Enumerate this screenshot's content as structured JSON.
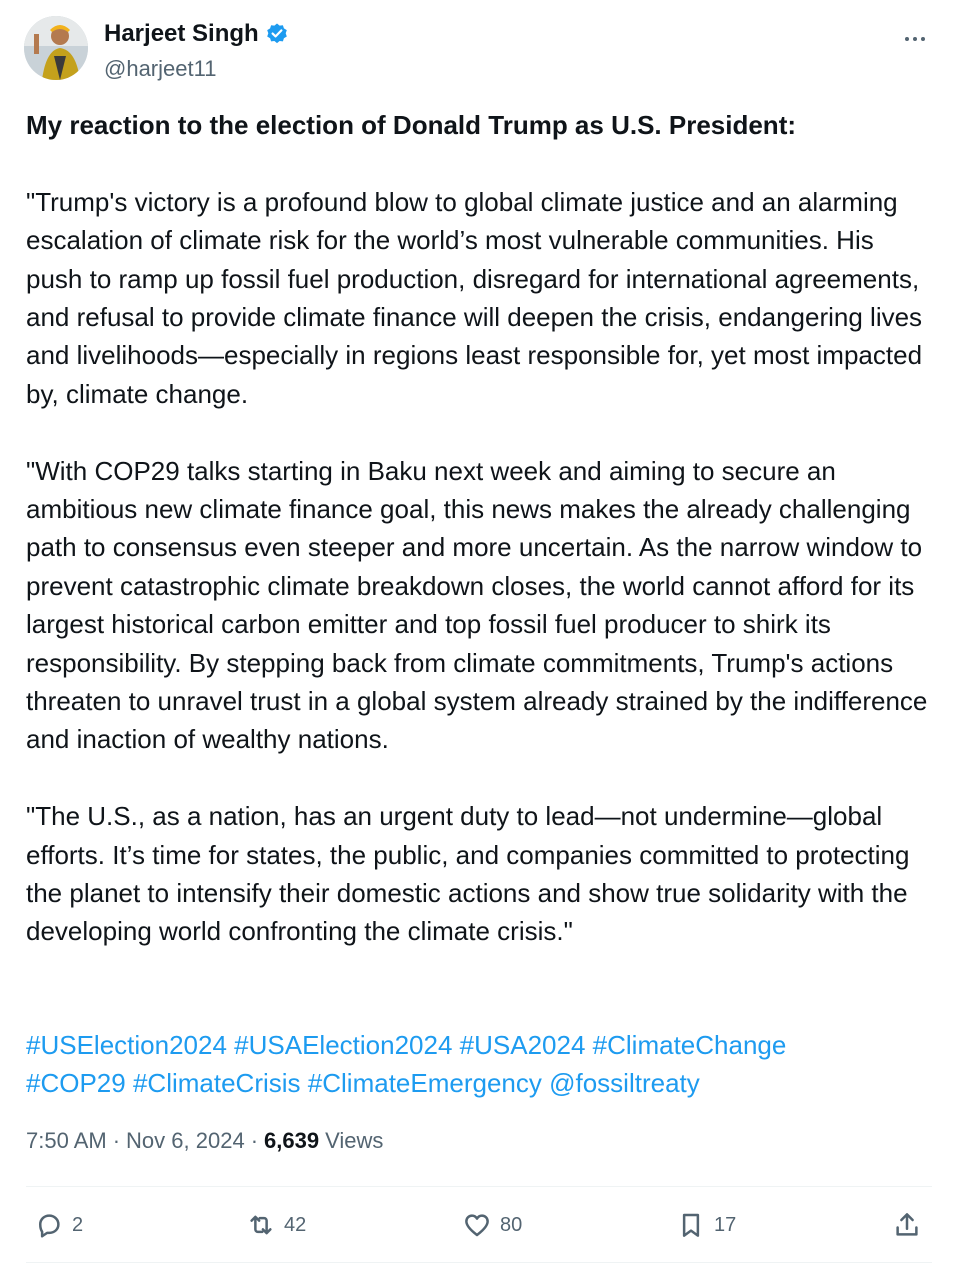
{
  "author": {
    "display_name": "Harjeet Singh",
    "handle": "@harjeet11",
    "verified": true,
    "avatar_icon": "profile-photo"
  },
  "post": {
    "lead": "My reaction to the election of Donald Trump as U.S. President:",
    "paragraphs": [
      "\"Trump's victory is a profound blow to global climate justice and an alarming escalation of climate risk for the world’s most vulnerable communities. His push to ramp up fossil fuel production, disregard for international agreements, and refusal to provide climate finance will deepen the crisis, endangering lives and livelihoods—especially in regions least responsible for, yet most impacted by, climate change.",
      "\"With COP29 talks starting in Baku next week and aiming to secure an ambitious new climate finance goal, this news makes the already challenging path to consensus even steeper and more uncertain. As the narrow window to prevent catastrophic climate breakdown closes, the world cannot afford for its largest historical carbon emitter and top fossil fuel producer to shirk its responsibility. By stepping back from climate commitments, Trump's actions threaten to unravel trust in a global system already strained by the indifference and inaction of wealthy nations.",
      "\"The U.S., as a nation, has an urgent duty to lead—not undermine—global efforts. It’s time for states, the public, and companies committed to protecting the planet to intensify their domestic actions and show true solidarity with the developing world confronting the climate crisis.\""
    ],
    "hashtags": [
      "#USElection2024",
      "#USAElection2024",
      "#USA2024",
      "#ClimateChange",
      "#COP29",
      "#ClimateCrisis",
      "#ClimateEmergency"
    ],
    "mention": "@fossiltreaty"
  },
  "meta": {
    "time": "7:50 AM",
    "date": "Nov 6, 2024",
    "views_count": "6,639",
    "views_label": "Views",
    "separator": "·"
  },
  "actions": {
    "replies": "2",
    "reposts": "42",
    "likes": "80",
    "bookmarks": "17"
  },
  "colors": {
    "link": "#1d9bf0",
    "secondary_text": "#536471",
    "primary_text": "#0f1419",
    "verified_badge": "#1d9bf0"
  }
}
